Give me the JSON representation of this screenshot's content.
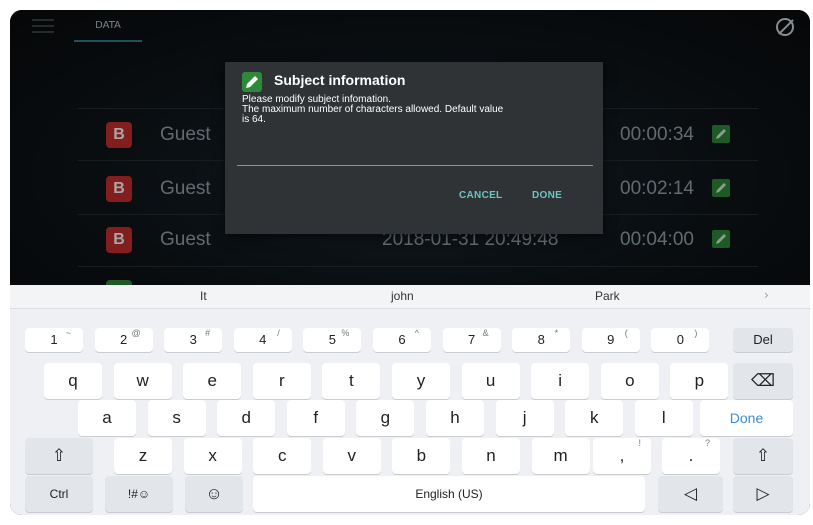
{
  "topbar": {
    "tab": "DATA"
  },
  "sessions": [
    {
      "badge": "B",
      "badge_color": "#c8312e",
      "name": "Guest",
      "date": "",
      "duration": "00:00:34"
    },
    {
      "badge": "B",
      "badge_color": "#c8312e",
      "name": "Guest",
      "date": "",
      "duration": "00:02:14"
    },
    {
      "badge": "B",
      "badge_color": "#c8312e",
      "name": "Guest",
      "date": "2018-01-31  20:49:48",
      "duration": "00:04:00"
    }
  ],
  "dialog": {
    "title": "Subject information",
    "message_lines": [
      "Please modify subject infomation.",
      "The maximum number of characters allowed. Default value",
      "is 64."
    ],
    "input_value": "",
    "cancel": "CANCEL",
    "done": "DONE"
  },
  "keyboard": {
    "suggestions": [
      "It",
      "john",
      "Park"
    ],
    "more": "›",
    "number_row": [
      {
        "main": "1",
        "sub": "~"
      },
      {
        "main": "2",
        "sub": "@"
      },
      {
        "main": "3",
        "sub": "#"
      },
      {
        "main": "4",
        "sub": "/"
      },
      {
        "main": "5",
        "sub": "%"
      },
      {
        "main": "6",
        "sub": "^"
      },
      {
        "main": "7",
        "sub": "&"
      },
      {
        "main": "8",
        "sub": "*"
      },
      {
        "main": "9",
        "sub": "("
      },
      {
        "main": "0",
        "sub": ")"
      }
    ],
    "del": "Del",
    "row_q": [
      "q",
      "w",
      "e",
      "r",
      "t",
      "y",
      "u",
      "i",
      "o",
      "p"
    ],
    "row_a": [
      "a",
      "s",
      "d",
      "f",
      "g",
      "h",
      "j",
      "k",
      "l"
    ],
    "done": "Done",
    "row_z": [
      "z",
      "x",
      "c",
      "v",
      "b",
      "n",
      "m"
    ],
    "comma": {
      "main": ",",
      "sub": "!"
    },
    "period": {
      "main": ".",
      "sub": "?"
    },
    "ctrl": "Ctrl",
    "symbols": "!#☺",
    "emoji": "☺",
    "space": "English (US)",
    "left": "◁",
    "right": "▷",
    "backspace": "⌫",
    "shift": "⇧"
  }
}
